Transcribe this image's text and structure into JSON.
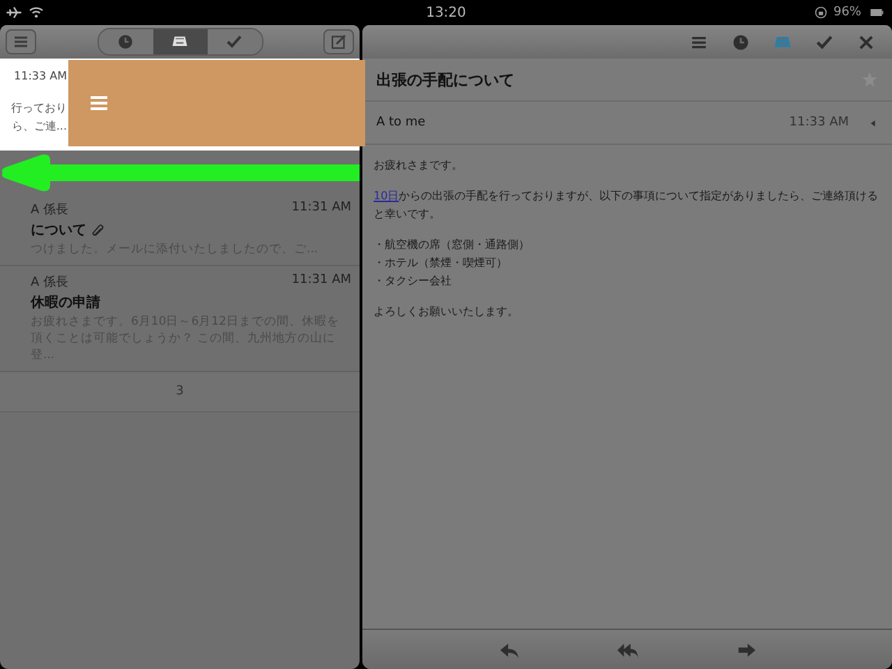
{
  "status_bar": {
    "time": "13:20",
    "battery": "96%"
  },
  "list_toolbar": {
    "tabs": [
      {
        "kind": "clock",
        "selected": false
      },
      {
        "kind": "inbox",
        "selected": true
      },
      {
        "kind": "check",
        "selected": false
      }
    ]
  },
  "swiped_item": {
    "time": "11:33 AM",
    "preview_lines": [
      "行っており",
      "ら、ご連..."
    ]
  },
  "messages": [
    {
      "sender": "A 係長",
      "time": "11:31 AM",
      "subject": "について",
      "attachment": true,
      "preview": "つけました。メールに添付いたしましたので、ご..."
    },
    {
      "sender": "A 係長",
      "time": "11:31 AM",
      "subject": "休暇の申請",
      "attachment": false,
      "preview": "お疲れさまです。6月10日～6月12日までの間、休暇を頂くことは可能でしょうか？ この間、九州地方の山に登..."
    }
  ],
  "pager": {
    "label": "3"
  },
  "reader_toolbar": {
    "tabs": [
      {
        "kind": "menu",
        "selected": false
      },
      {
        "kind": "clock",
        "selected": false
      },
      {
        "kind": "inbox",
        "selected": true
      },
      {
        "kind": "check",
        "selected": false
      },
      {
        "kind": "close",
        "selected": false
      }
    ]
  },
  "message": {
    "subject": "出張の手配について",
    "starred": false,
    "from_line": "A to me",
    "time": "11:33 AM",
    "body": [
      {
        "kind": "text",
        "text": "お疲れさまです。"
      },
      {
        "kind": "text",
        "link": "10日",
        "text": "からの出張の手配を行っておりますが、以下の事項について指定がありましたら、ご連絡頂けると幸いです。"
      },
      {
        "kind": "list",
        "items": [
          "・航空機の席（窓側・通路側）",
          "・ホテル（禁煙・喫煙可）",
          "・タクシー会社"
        ]
      },
      {
        "kind": "text",
        "text": "よろしくお願いいたします。"
      }
    ]
  }
}
